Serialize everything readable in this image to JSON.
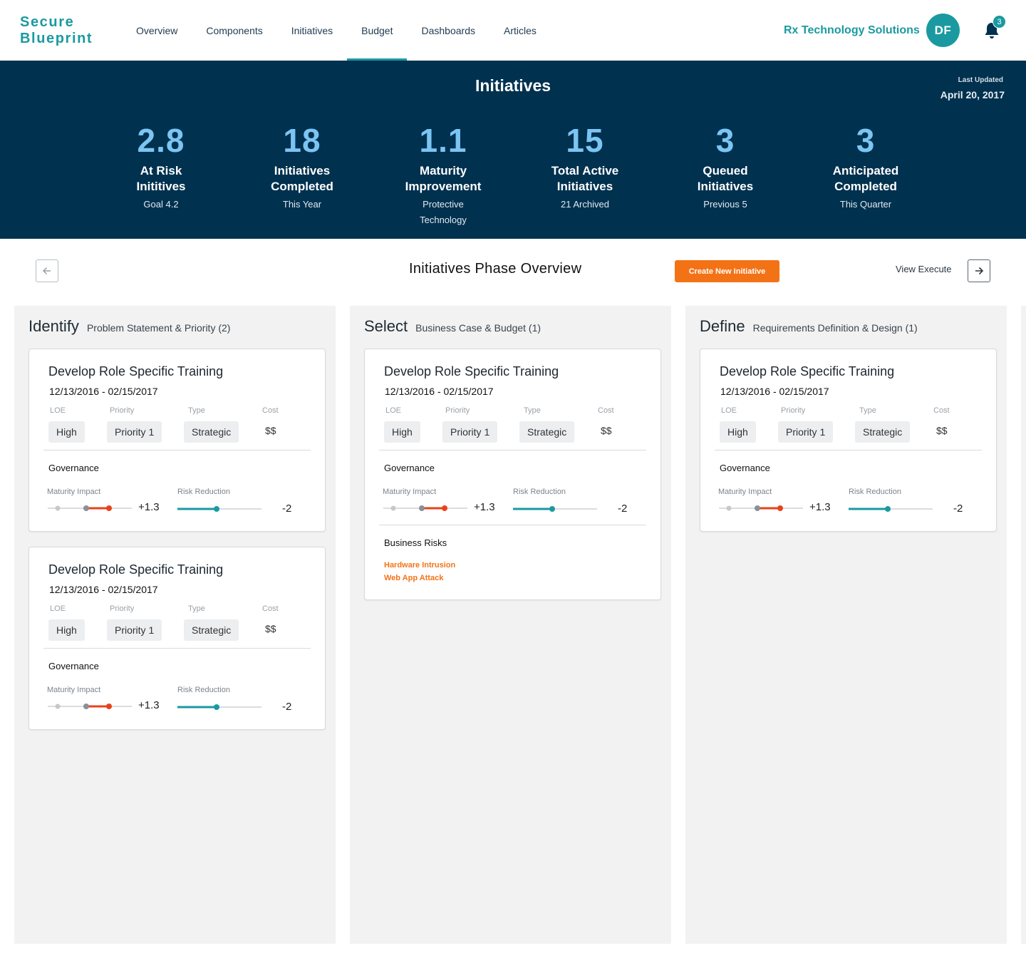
{
  "app": {
    "logo_line1": "Secure",
    "logo_line2": "Blueprint",
    "nav": [
      "Overview",
      "Components",
      "Initiatives",
      "Budget",
      "Dashboards",
      "Articles"
    ],
    "active_nav": "Budget",
    "company": "Rx Technology Solutions",
    "avatar_initials": "DF",
    "notification_count": "3",
    "accent_color": "#1a9aa0",
    "hero_color": "#00314f",
    "action_color": "#f47216"
  },
  "hero": {
    "title": "Initiatives",
    "last_updated_label": "Last Updated",
    "last_updated_date": "April 20, 2017",
    "stats": [
      {
        "value": "2.8",
        "label": "At Risk Inititives",
        "sub": "Goal 4.2"
      },
      {
        "value": "18",
        "label": "Initiatives Completed",
        "sub": "This Year"
      },
      {
        "value": "1.1",
        "label": "Maturity Improvement",
        "sub": "Protective Technology"
      },
      {
        "value": "15",
        "label": "Total Active Initiatives",
        "sub": "21 Archived"
      },
      {
        "value": "3",
        "label": "Queued Initiatives",
        "sub": "Previous 5"
      },
      {
        "value": "3",
        "label": "Anticipated Completed",
        "sub": "This Quarter"
      }
    ]
  },
  "phase": {
    "title": "Initiatives Phase Overview",
    "create_label": "Create New Initiative",
    "view_execute_label": "View Execute",
    "back_icon": "arrow-left-icon",
    "next_icon": "arrow-right-icon"
  },
  "card_labels": {
    "loe": "LOE",
    "priority": "Priority",
    "type": "Type",
    "cost": "Cost",
    "governance": "Governance",
    "maturity_impact": "Maturity Impact",
    "risk_reduction": "Risk Reduction",
    "business_risks": "Business Risks"
  },
  "columns": [
    {
      "name": "Identify",
      "desc": "Problem Statement & Priority (2)",
      "cards": [
        {
          "title": "Develop Role Specific Training",
          "dates": "12/13/2016 - 02/15/2017",
          "loe": "High",
          "priority": "Priority 1",
          "type": "Strategic",
          "cost": "$$",
          "maturity": "+1.3",
          "risk": "-2",
          "business_risks": []
        },
        {
          "title": "Develop Role Specific Training",
          "dates": "12/13/2016 - 02/15/2017",
          "loe": "High",
          "priority": "Priority 1",
          "type": "Strategic",
          "cost": "$$",
          "maturity": "+1.3",
          "risk": "-2",
          "business_risks": []
        }
      ]
    },
    {
      "name": "Select",
      "desc": "Business Case & Budget (1)",
      "cards": [
        {
          "title": "Develop Role Specific Training",
          "dates": "12/13/2016 - 02/15/2017",
          "loe": "High",
          "priority": "Priority 1",
          "type": "Strategic",
          "cost": "$$",
          "maturity": "+1.3",
          "risk": "-2",
          "business_risks": [
            "Hardware Intrusion",
            "Web App Attack"
          ]
        }
      ]
    },
    {
      "name": "Define",
      "desc": "Requirements Definition & Design (1)",
      "cards": [
        {
          "title": "Develop Role Specific Training",
          "dates": "12/13/2016 - 02/15/2017",
          "loe": "High",
          "priority": "Priority 1",
          "type": "Strategic",
          "cost": "$$",
          "maturity": "+1.3",
          "risk": "-2",
          "business_risks": []
        }
      ]
    }
  ]
}
